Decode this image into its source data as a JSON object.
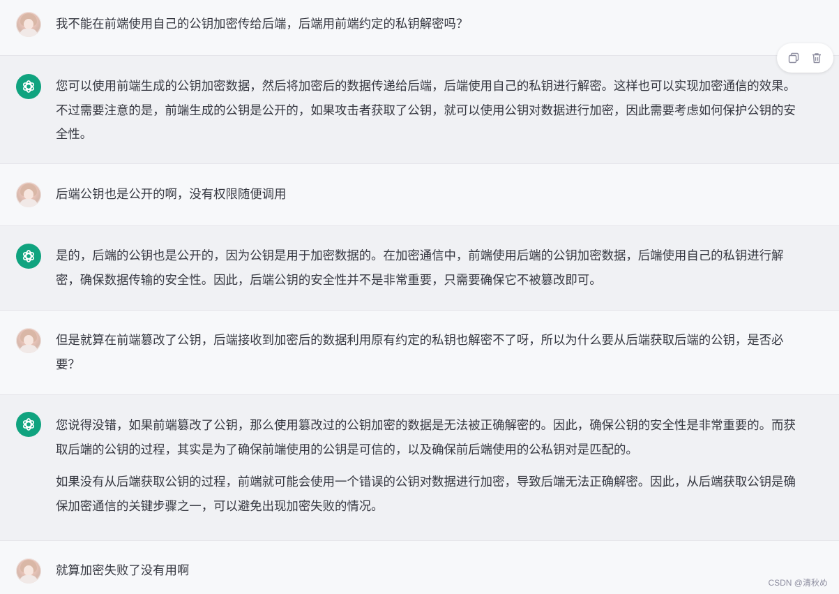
{
  "conversation": {
    "messages": [
      {
        "role": "user",
        "paragraphs": [
          "我不能在前端使用自己的公钥加密传给后端，后端用前端约定的私钥解密吗？"
        ]
      },
      {
        "role": "assistant",
        "paragraphs": [
          "您可以使用前端生成的公钥加密数据，然后将加密后的数据传递给后端，后端使用自己的私钥进行解密。这样也可以实现加密通信的效果。不过需要注意的是，前端生成的公钥是公开的，如果攻击者获取了公钥，就可以使用公钥对数据进行加密，因此需要考虑如何保护公钥的安全性。"
        ]
      },
      {
        "role": "user",
        "paragraphs": [
          "后端公钥也是公开的啊，没有权限随便调用"
        ]
      },
      {
        "role": "assistant",
        "paragraphs": [
          "是的，后端的公钥也是公开的，因为公钥是用于加密数据的。在加密通信中，前端使用后端的公钥加密数据，后端使用自己的私钥进行解密，确保数据传输的安全性。因此，后端公钥的安全性并不是非常重要，只需要确保它不被篡改即可。"
        ]
      },
      {
        "role": "user",
        "paragraphs": [
          "但是就算在前端篡改了公钥，后端接收到加密后的数据利用原有约定的私钥也解密不了呀，所以为什么要从后端获取后端的公钥，是否必要？"
        ]
      },
      {
        "role": "assistant",
        "paragraphs": [
          "您说得没错，如果前端篡改了公钥，那么使用篡改过的公钥加密的数据是无法被正确解密的。因此，确保公钥的安全性是非常重要的。而获取后端的公钥的过程，其实是为了确保前端使用的公钥是可信的，以及确保前后端使用的公私钥对是匹配的。",
          "如果没有从后端获取公钥的过程，前端就可能会使用一个错误的公钥对数据进行加密，导致后端无法正确解密。因此，从后端获取公钥是确保加密通信的关键步骤之一，可以避免出现加密失败的情况。"
        ]
      },
      {
        "role": "user",
        "paragraphs": [
          "就算加密失败了没有用啊"
        ]
      }
    ]
  },
  "actions": {
    "copy_icon": "copy-icon",
    "delete_icon": "trash-icon"
  },
  "colors": {
    "assistant_avatar": "#10a37f",
    "assistant_bg": "#f0f1f4",
    "user_bg": "#f7f8fa"
  },
  "watermark": "CSDN @清秋め"
}
